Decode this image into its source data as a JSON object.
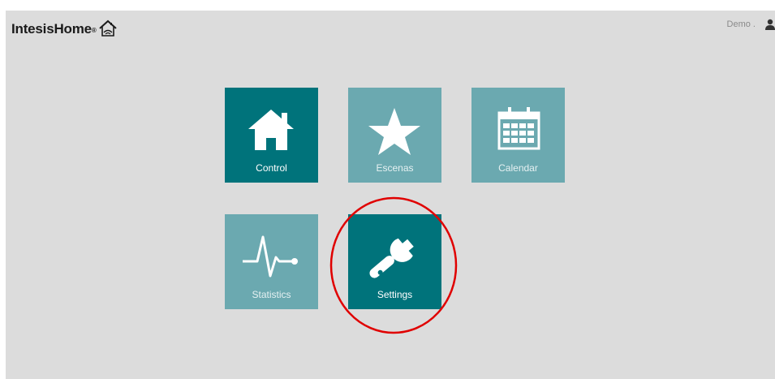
{
  "header": {
    "logo_text": "IntesisHome",
    "logo_reg": "®",
    "user_name": "Demo ."
  },
  "tiles": [
    {
      "label": "Control",
      "icon": "house-icon",
      "state": "active"
    },
    {
      "label": "Escenas",
      "icon": "star-icon",
      "state": "inactive"
    },
    {
      "label": "Calendar",
      "icon": "calendar-icon",
      "state": "inactive"
    },
    {
      "label": "Statistics",
      "icon": "pulse-icon",
      "state": "inactive"
    },
    {
      "label": "Settings",
      "icon": "wrench-icon",
      "state": "active"
    }
  ],
  "colors": {
    "tile_active": "#00737b",
    "tile_inactive": "#6ba9b0",
    "background": "#dcdcdc",
    "highlight": "#e00000"
  }
}
